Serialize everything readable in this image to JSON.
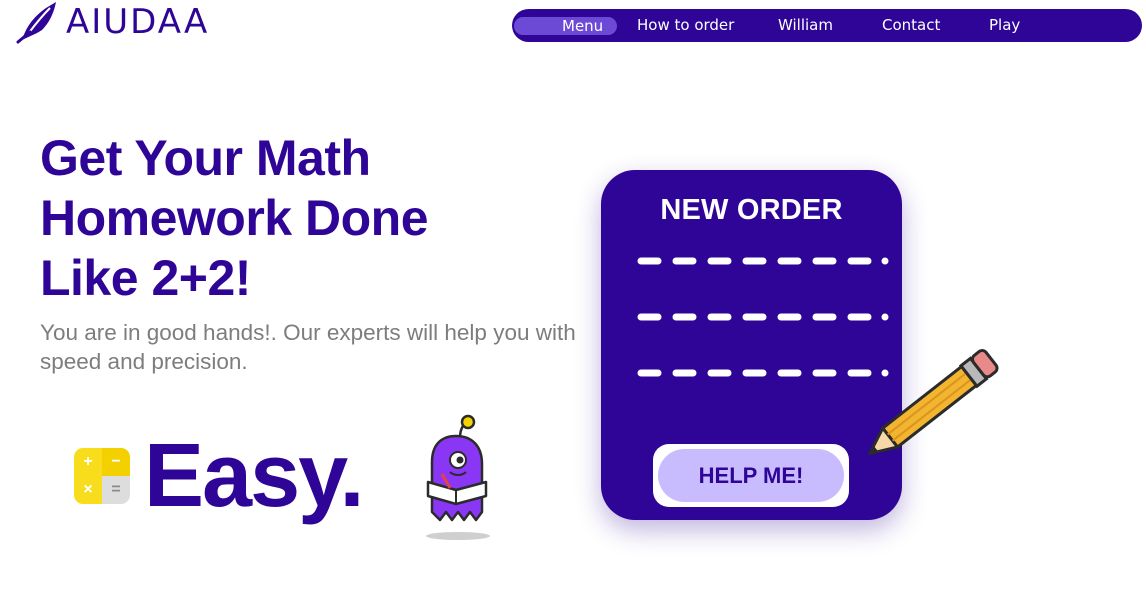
{
  "brand": {
    "name": "AIUDAA",
    "logo_icon": "leaf-feather-icon",
    "color": "#2e0596"
  },
  "nav": {
    "items": [
      {
        "label": "Menu",
        "active": true
      },
      {
        "label": "How to order",
        "active": false
      },
      {
        "label": "William",
        "active": false
      },
      {
        "label": "Contact",
        "active": false
      },
      {
        "label": "Play",
        "active": false
      }
    ],
    "background": "#2e0596",
    "active_pill": "#6c4ad6"
  },
  "hero": {
    "title_lines": [
      "Get Your Math",
      "Homework Done",
      "Like 2+2!"
    ],
    "subtitle": "You are in good hands!. Our experts will help you with speed and precision."
  },
  "easy": {
    "text": "Easy.",
    "calculator_icon": "calculator-icon",
    "calculator_keys": [
      "+",
      "−",
      "×",
      "="
    ],
    "mascot_icon": "ghost-reading-book-icon"
  },
  "order_card": {
    "title": "NEW ORDER",
    "cta_label": "HELP ME!",
    "card_color": "#2e0596",
    "cta_color": "#c8bcff",
    "decor_icon": "pencil-icon"
  }
}
